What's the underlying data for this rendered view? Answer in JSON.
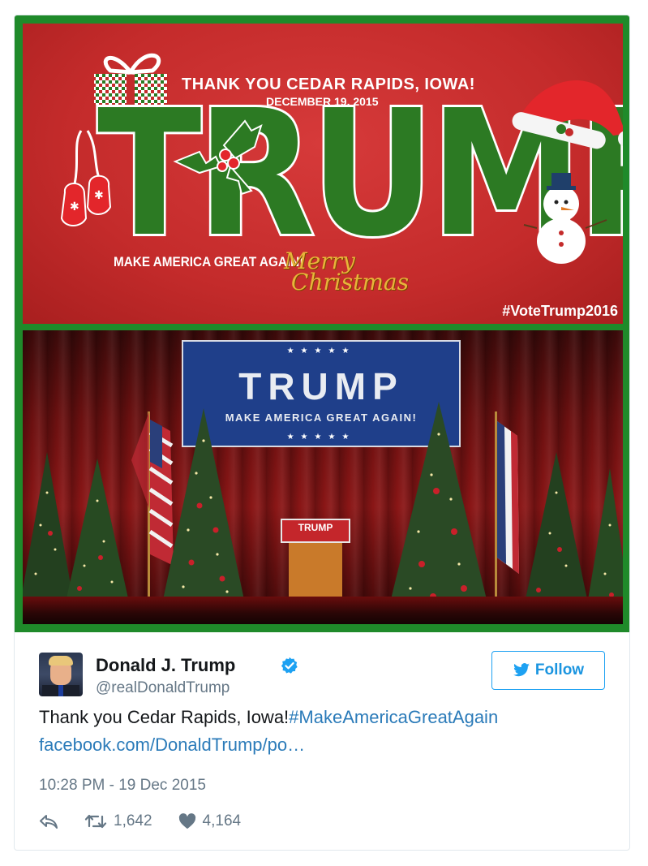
{
  "media": {
    "banner": {
      "thanks": "THANK YOU CEDAR RAPIDS, IOWA!",
      "date": "DECEMBER 19, 2015",
      "big_word": "TRUMP",
      "slogan": "MAKE AMERICA GREAT AGAIN!",
      "merry": "Merry\n Christmas",
      "hashtag": "#VoteTrump2016"
    },
    "photo": {
      "stage_banner_name": "TRUMP",
      "stage_banner_sub": "MAKE AMERICA GREAT AGAIN!",
      "stage_banner_stars": "★★★★★",
      "podium_sign": "TRUMP"
    }
  },
  "author": {
    "display_name": "Donald J. Trump",
    "handle": "@realDonaldTrump",
    "verified": true
  },
  "follow": {
    "label": "Follow"
  },
  "tweet": {
    "text": "Thank you Cedar Rapids, Iowa!",
    "hashtag": "#MakeAmericaGreatAgain",
    "link": "facebook.com/DonaldTrump/po…"
  },
  "timestamp": "10:28 PM - 19 Dec 2015",
  "actions": {
    "retweets": "1,642",
    "likes": "4,164"
  },
  "colors": {
    "link": "#2b7bb9",
    "follow_blue": "#1da1f2",
    "banner_red": "#c42b2b",
    "frame_green": "#1f8a2a"
  },
  "icons": {
    "reply": "reply-icon",
    "retweet": "retweet-icon",
    "like": "heart-icon",
    "verified": "verified-badge-icon",
    "follow": "twitter-bird-icon"
  }
}
